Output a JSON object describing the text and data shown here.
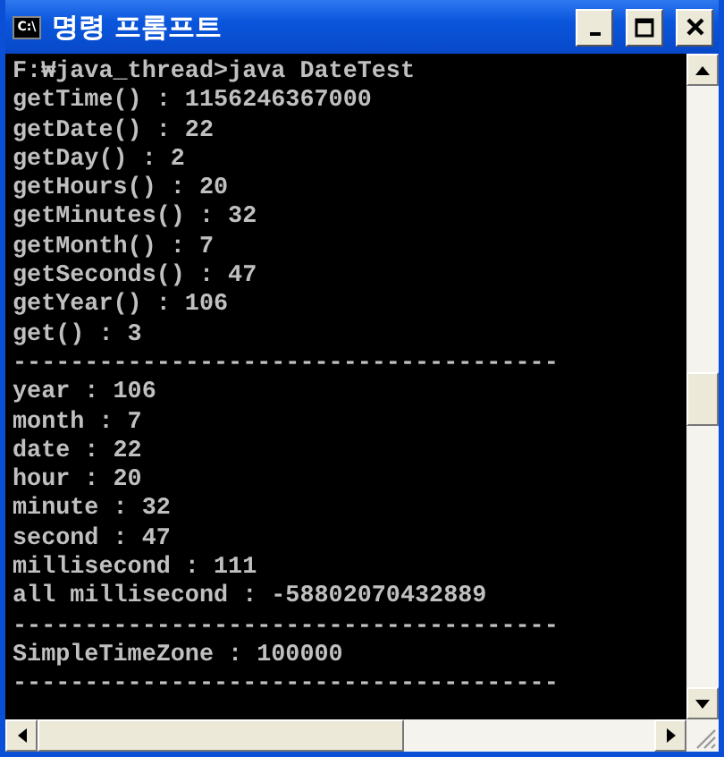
{
  "window": {
    "title": "명령 프롬프트",
    "app_icon_text": "C:\\"
  },
  "console": {
    "lines": [
      "F:₩java_thread>java DateTest",
      "getTime() : 1156246367000",
      "getDate() : 22",
      "getDay() : 2",
      "getHours() : 20",
      "getMinutes() : 32",
      "getMonth() : 7",
      "getSeconds() : 47",
      "getYear() : 106",
      "get() : 3",
      "--------------------------------------",
      "year : 106",
      "month : 7",
      "date : 22",
      "hour : 20",
      "minute : 32",
      "second : 47",
      "millisecond : 111",
      "all millisecond : -58802070432889",
      "--------------------------------------",
      "SimpleTimeZone : 100000",
      "--------------------------------------"
    ]
  }
}
